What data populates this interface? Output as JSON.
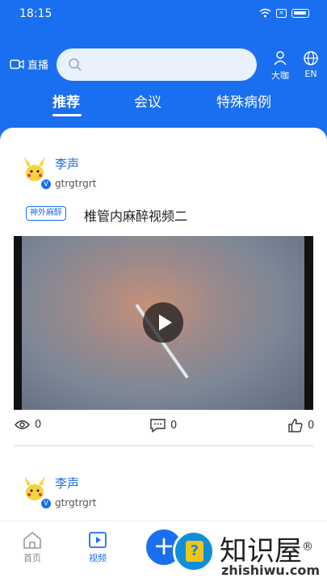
{
  "status": {
    "time": "18:15"
  },
  "header": {
    "live_label": "直播",
    "search_placeholder": "",
    "dakai_label": "大咖",
    "lang_label": "EN"
  },
  "tabs": [
    {
      "label": "推荐",
      "active": true
    },
    {
      "label": "会议",
      "active": false
    },
    {
      "label": "特殊病例",
      "active": false
    }
  ],
  "posts": [
    {
      "author": "李声",
      "handle": "gtrgtrgrt",
      "tag": "神外麻醉",
      "title": "椎管内麻醉视频二",
      "views": "0",
      "comments": "0",
      "likes": "0"
    },
    {
      "author": "李声",
      "handle": "gtrgtrgrt"
    }
  ],
  "bottom_nav": [
    {
      "label": "首页",
      "icon": "home-icon",
      "active": false
    },
    {
      "label": "视频",
      "icon": "video-icon",
      "active": true
    },
    {
      "label": "+",
      "icon": "plus-icon",
      "active": false
    }
  ],
  "watermark": {
    "title": "知识屋",
    "subtitle": "zhishiwu.com",
    "reg": "®",
    "logo_mark": "?"
  },
  "colors": {
    "brand": "#1a6ef0",
    "background": "#ffffff"
  }
}
